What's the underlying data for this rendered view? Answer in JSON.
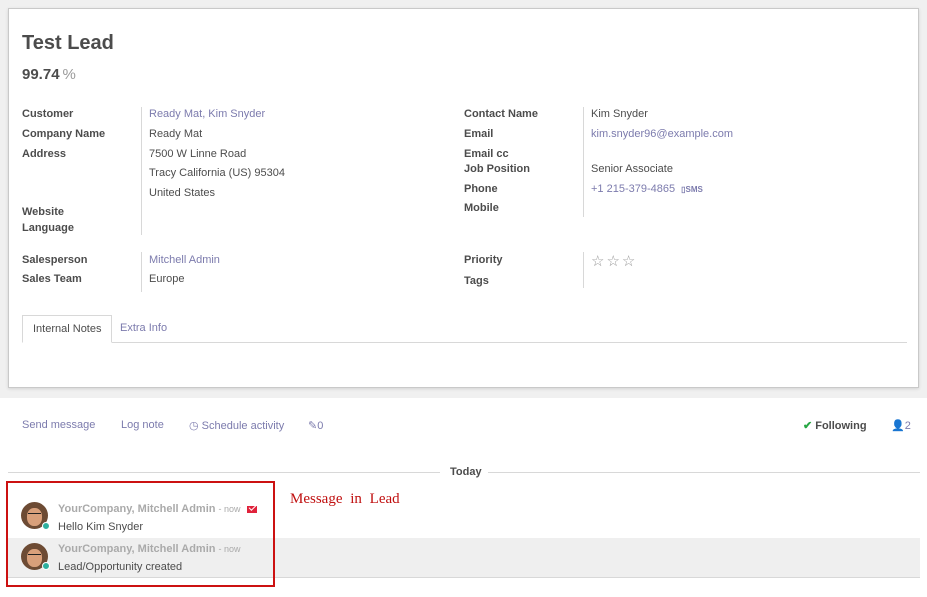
{
  "record": {
    "title": "Test Lead",
    "probability_value": "99.74",
    "probability_unit": "%"
  },
  "left_fields": {
    "customer_label": "Customer",
    "customer_value": "Ready Mat, Kim Snyder",
    "company_label": "Company Name",
    "company_value": "Ready Mat",
    "address_label": "Address",
    "address_street": "7500 W Linne Road",
    "address_city": "Tracy",
    "address_state": "California (US)",
    "address_zip": "95304",
    "address_country": "United States",
    "website_label": "Website",
    "language_label": "Language",
    "salesperson_label": "Salesperson",
    "salesperson_value": "Mitchell Admin",
    "sales_team_label": "Sales Team",
    "sales_team_value": "Europe"
  },
  "right_fields": {
    "contact_label": "Contact Name",
    "contact_value": "Kim Snyder",
    "email_label": "Email",
    "email_value": "kim.snyder96@example.com",
    "email_cc_label": "Email cc",
    "job_label": "Job Position",
    "job_value": "Senior Associate",
    "phone_label": "Phone",
    "phone_value": "+1 215-379-4865",
    "sms_label": "SMS",
    "mobile_label": "Mobile",
    "priority_label": "Priority",
    "priority_stars": "☆☆☆",
    "priority_value": 0,
    "priority_max": 3,
    "tags_label": "Tags"
  },
  "tabs": [
    {
      "label": "Internal Notes",
      "active": true
    },
    {
      "label": "Extra Info",
      "active": false
    }
  ],
  "chatter": {
    "send_message": "Send message",
    "log_note": "Log note",
    "schedule_activity": "Schedule activity",
    "attachments_count": "0",
    "following": "Following",
    "followers_count": "2",
    "date_separator": "Today"
  },
  "messages": [
    {
      "author": "YourCompany, Mitchell Admin",
      "when": "- now",
      "body": "Hello Kim Snyder",
      "has_email_icon": true
    },
    {
      "author": "YourCompany, Mitchell Admin",
      "when": "- now",
      "body": "Lead/Opportunity created",
      "has_email_icon": false
    }
  ],
  "annotation": {
    "text": "Message in Lead"
  },
  "colors": {
    "link": "#7c7bad",
    "annotation_red": "#cc1111",
    "status_online": "#2eb09f",
    "following_check": "#28a745"
  }
}
